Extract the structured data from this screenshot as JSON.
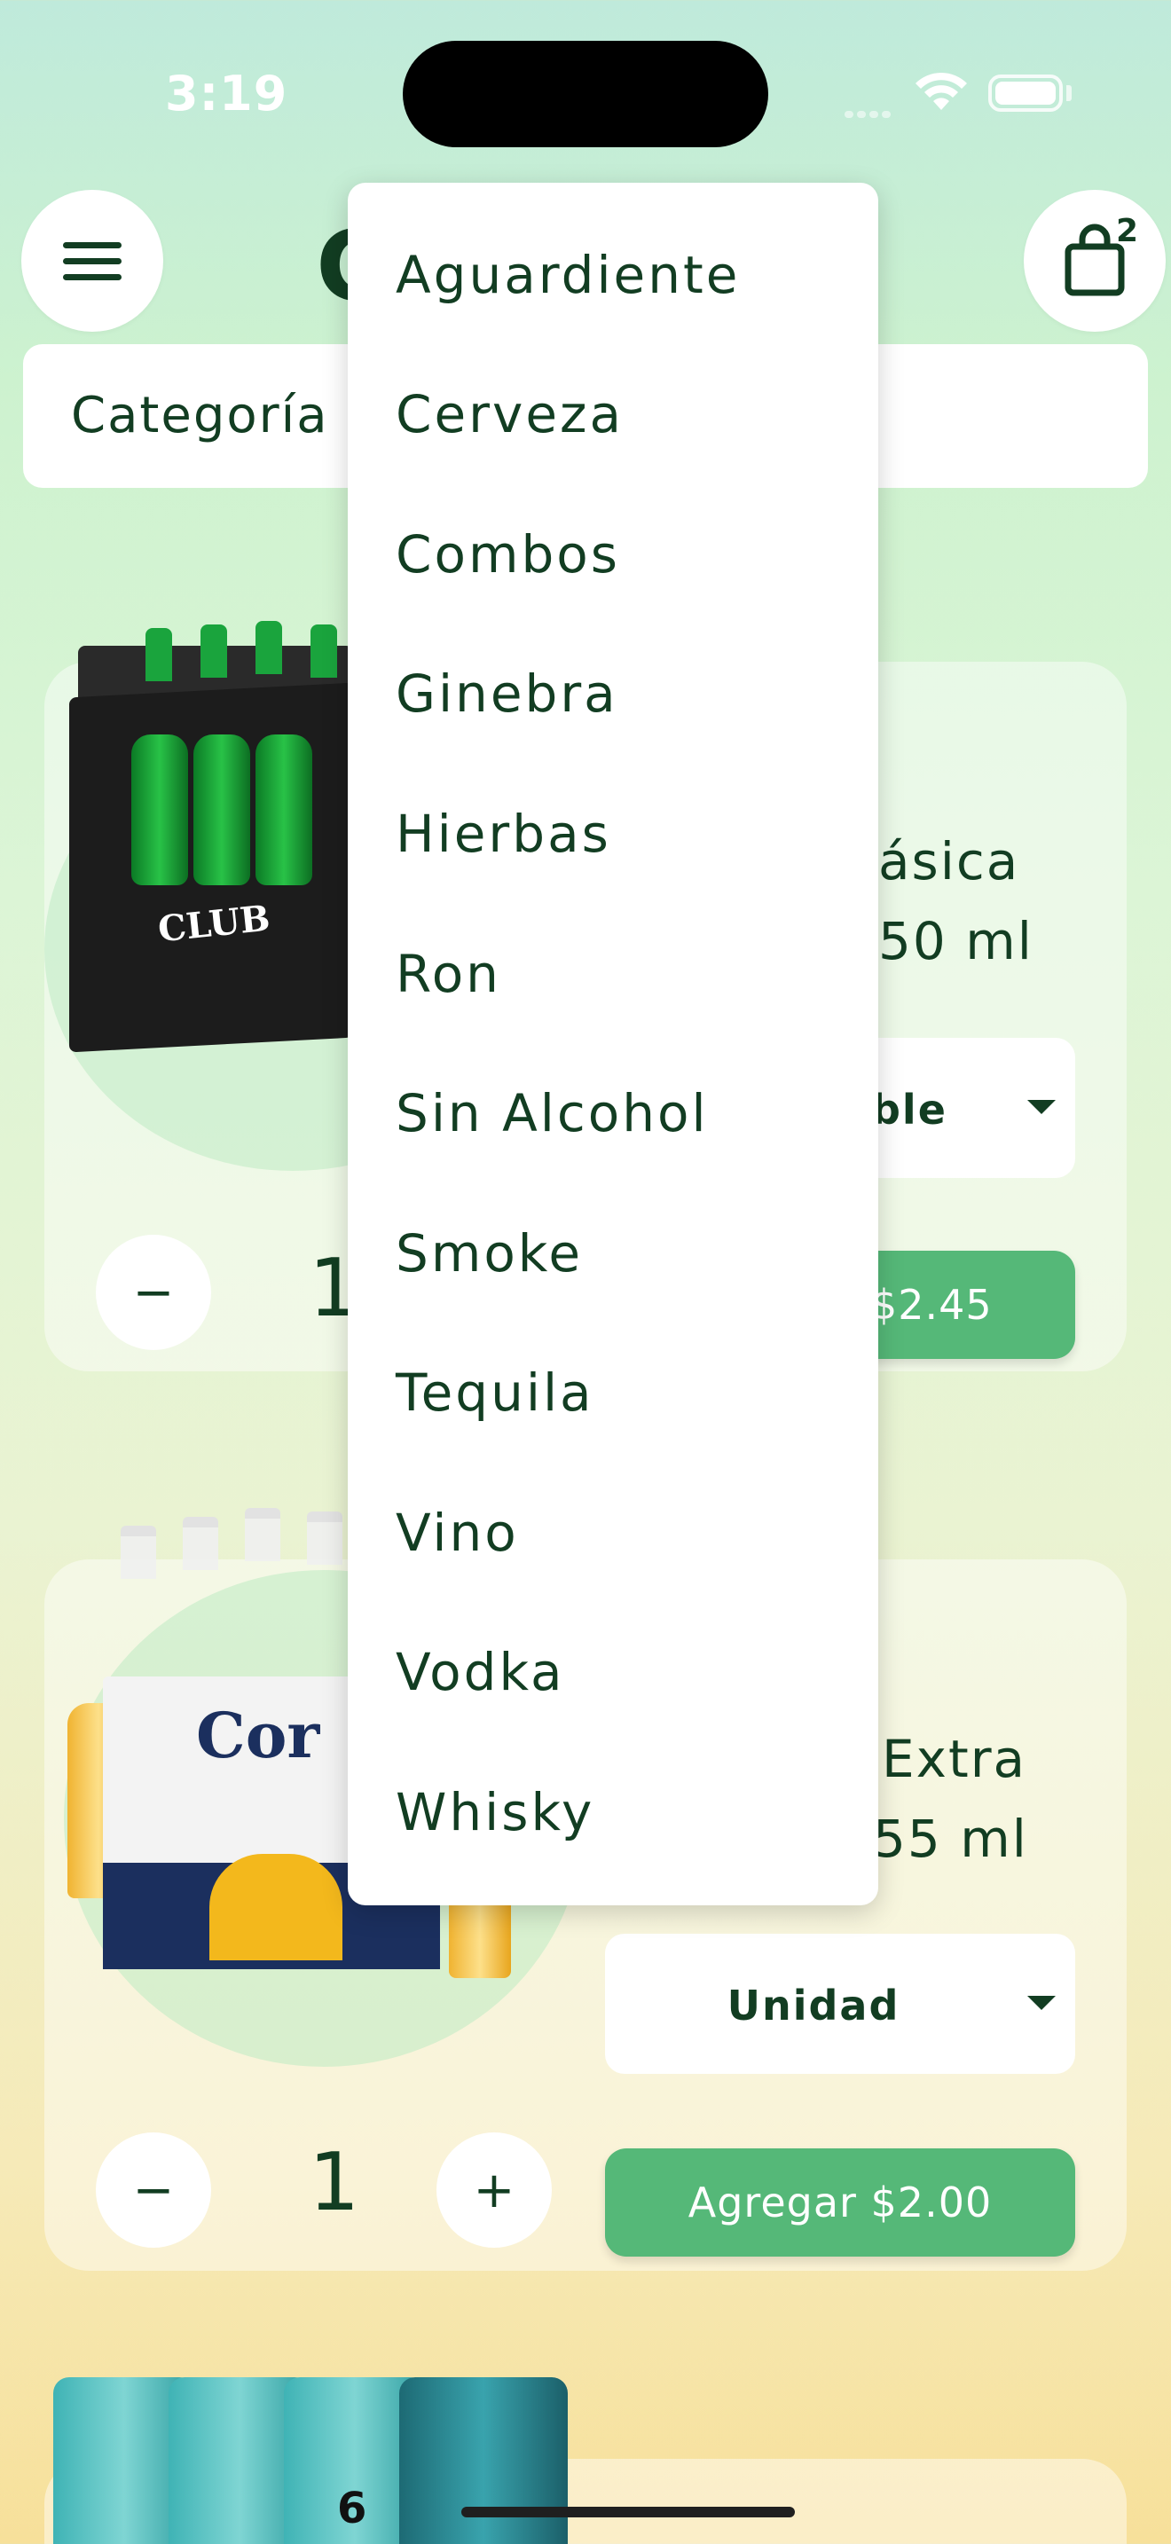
{
  "status_bar": {
    "time": "3:19"
  },
  "header": {
    "menu_icon": "hamburger-menu-icon",
    "title_partial": "C",
    "cart_icon": "shopping-bag-icon",
    "cart_count": "2"
  },
  "category_filter": {
    "label_partial": "Categoría"
  },
  "dropdown": {
    "options": [
      "Aguardiente",
      "Cerveza",
      "Combos",
      "Ginebra",
      "Hierbas",
      "Ron",
      "Sin Alcohol",
      "Smoke",
      "Tequila",
      "Vino",
      "Vodka",
      "Whisky"
    ]
  },
  "products": [
    {
      "name_line1_partial": "ásica",
      "name_line2_partial": "50 ml",
      "unit_partial": "ble",
      "quantity": "1",
      "add_label_partial": "$2.45",
      "image_text": "CLUB"
    },
    {
      "name_line1_partial": "Extra",
      "name_line2_partial": "55 ml",
      "unit": "Unidad",
      "quantity": "1",
      "add_label": "Agregar $2.00",
      "image_text": "Cor"
    },
    {
      "image_text": "6"
    }
  ],
  "quantity_controls": {
    "decrement": "−",
    "increment": "+"
  },
  "colors": {
    "primary_text": "#123d22",
    "add_button": "#55b878",
    "surface": "#ffffff"
  }
}
